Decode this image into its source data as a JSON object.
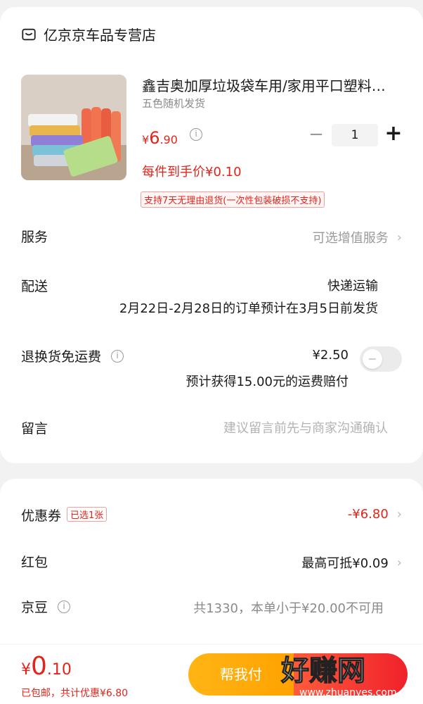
{
  "shop": {
    "name": "亿京京车品专营店"
  },
  "product": {
    "title": "鑫吉奥加厚垃圾袋车用/家用平口塑料…",
    "variant": "五色随机发货",
    "price_symbol": "¥",
    "price_int": "6",
    "price_dec": ".90",
    "quantity": "1",
    "unit_price": "每件到手价¥0.10",
    "return_policy": "支持7天无理由退货(一次性包装破损不支持)"
  },
  "service": {
    "label": "服务",
    "value": "可选增值服务"
  },
  "delivery": {
    "label": "配送",
    "method": "快递运输",
    "note": "2月22日-2月28日的订单预计在3月5日前发货"
  },
  "return_shipping": {
    "label": "退换货免运费",
    "price": "¥2.50",
    "note": "预计获得15.00元的运费赔付",
    "enabled": false
  },
  "message": {
    "label": "留言",
    "placeholder": "建议留言前先与商家沟通确认"
  },
  "coupon": {
    "label": "优惠券",
    "badge": "已选1张",
    "value": "-¥6.80"
  },
  "red_packet": {
    "label": "红包",
    "value": "最高可抵¥0.09"
  },
  "jingdou": {
    "label": "京豆",
    "value": "共1330，本单小于¥20.00不可用"
  },
  "bottom": {
    "total_symbol": "¥",
    "total_int": "0",
    "total_dec": ".10",
    "summary": "已包邮，共计优惠¥6.80",
    "help_pay": "帮我付",
    "watermark_text": "好赚网",
    "watermark_url": "www.zhuanyes.com"
  },
  "colors": {
    "accent_red": "#e1251b",
    "help_pay_orange": "#ffa200",
    "background": "#f2f2f2"
  },
  "icons": [
    "shop-icon",
    "info-icon",
    "chevron-right-icon",
    "minus-icon",
    "plus-icon",
    "toggle-switch"
  ]
}
